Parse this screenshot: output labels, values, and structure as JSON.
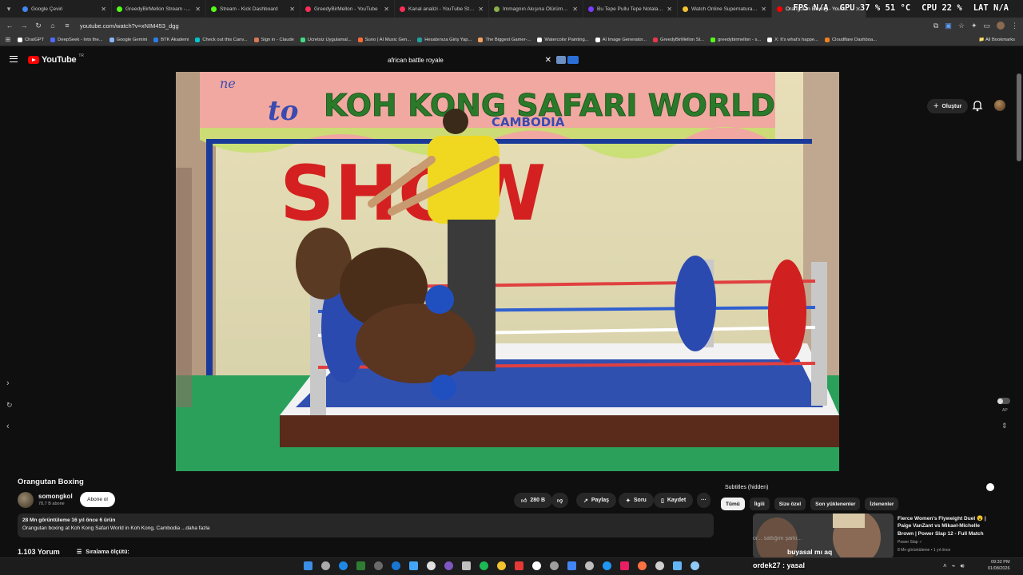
{
  "browser": {
    "tabs": [
      {
        "title": "Google Çeviri",
        "color": "#4285f4"
      },
      {
        "title": "GreedyBirMellon Stream - Wat",
        "color": "#53fc18"
      },
      {
        "title": "Stream - Kick Dashboard",
        "color": "#53fc18"
      },
      {
        "title": "GreedyBirMellon - YouTube",
        "color": "#ff2d55"
      },
      {
        "title": "Kanal analizi - YouTube Studio",
        "color": "#ff2d55"
      },
      {
        "title": "İmmagnın Akışına Ölürüm Türkü",
        "color": "#8ab04a"
      },
      {
        "title": "Bu Tepe Pullu Tepe Notaları | N",
        "color": "#7a3cff"
      },
      {
        "title": "Watch Online Supernatural Sea",
        "color": "#f2c230"
      },
      {
        "title": "Orangutan Boxing - YouTube",
        "color": "#ff0000",
        "active": true
      }
    ],
    "overlay": {
      "fps": "FPS N/A",
      "gpu": "GPU 37 % 51 °C",
      "cpu": "CPU 22 %",
      "lat": "LAT N/A"
    },
    "url": "youtube.com/watch?v=xNIM453_dgg",
    "bookmarks": [
      {
        "label": "ChatGPT",
        "color": "#ffffff"
      },
      {
        "label": "DeepSeek - Into the...",
        "color": "#4d6bfe"
      },
      {
        "label": "Google Gemini",
        "color": "#8ab4f8"
      },
      {
        "label": "BTK Akademi",
        "color": "#2b7de9"
      },
      {
        "label": "Check out this Canv...",
        "color": "#00c4cc"
      },
      {
        "label": "Sign in - Claude",
        "color": "#d97757"
      },
      {
        "label": "Ücretsiz Uygulamal...",
        "color": "#3ddc84"
      },
      {
        "label": "Suno | AI Music Gen...",
        "color": "#ff6b35"
      },
      {
        "label": "Hesabınıza Giriş Yap...",
        "color": "#21a0a0"
      },
      {
        "label": "The Biggest Gamer-...",
        "color": "#f4a261"
      },
      {
        "label": "Watercolor Painting...",
        "color": "#ffffff"
      },
      {
        "label": "AI Image Generator...",
        "color": "#ffffff"
      },
      {
        "label": "GreedyBirMellon St...",
        "color": "#e63946"
      },
      {
        "label": "greedybirmellon - s...",
        "color": "#53fc18"
      },
      {
        "label": "X: It's what's happe...",
        "color": "#ffffff"
      },
      {
        "label": "Cloudflare Dashboa...",
        "color": "#f38020"
      }
    ],
    "bookmarks_all": "All Bookmarks"
  },
  "youtube": {
    "logo_text": "YouTube",
    "region": "TR",
    "search_value": "african battle royale",
    "create_label": "Oluştur"
  },
  "video": {
    "title": "Orangutan Boxing",
    "banner_text": "KOH KONG SAFARI WORLD",
    "banner_sub": "CAMBODIA",
    "banner_left": "to",
    "show_text": "SHOW",
    "channel": "somongkol",
    "subscribers": "78,7 B abone",
    "subscribe_label": "Abone ol",
    "likes": "280 B",
    "share_label": "Paylaş",
    "ask_label": "Soru",
    "save_label": "Kaydet",
    "desc_stats": "28 Mn görüntüleme  16 yıl önce  6 ürün",
    "desc_text": "Orangutan boxing at Koh Kong Safari World in Koh Kong, Cambodia ...daha fazla",
    "comments_count": "1.103 Yorum",
    "sort_label": "Sıralama ölçütü:",
    "autoplay_label": "AP"
  },
  "sidebar": {
    "chat_header": "Subtitles (hidden)",
    "chips": [
      {
        "label": "Tümü",
        "active": true
      },
      {
        "label": "İlgili"
      },
      {
        "label": "Size özel"
      },
      {
        "label": "Son yüklenenler"
      },
      {
        "label": "İzlenenler"
      }
    ],
    "rec": {
      "title": "Fierce Women's Flyweight Duel 😮 | Paige VanZant vs Mikael-Michelle Brown | Power Slap 12 - Full Match",
      "channel": "Power Slap ✓",
      "meta": "8 Mn görüntüleme • 1 yıl önce"
    },
    "chat_lines": [
      "or... sattığım şarkı...",
      "buyasal mı aq",
      "ordek27 : yasal"
    ]
  },
  "taskbar": {
    "time": "09:32 PM",
    "date": "01/08/2026"
  },
  "colors": {
    "accent": "#ff0000",
    "bg": "#0f0f0f"
  }
}
